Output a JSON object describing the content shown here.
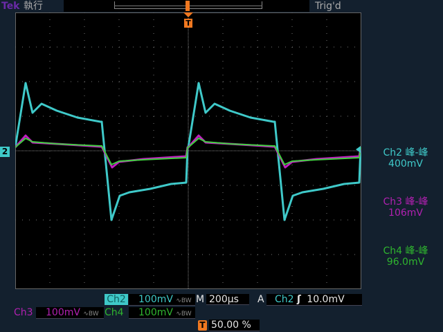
{
  "top": {
    "brand": "Tek",
    "run_state": "執行",
    "trigger_status": "Trig'd",
    "trigger_marker": "T"
  },
  "readouts": [
    {
      "label": "Ch2 峰-峰",
      "value": "400mV",
      "color": "#3fc9c9"
    },
    {
      "label": "Ch3 峰-峰",
      "value": "106mV",
      "color": "#b020b0"
    },
    {
      "label": "Ch4 峰-峰",
      "value": "96.0mV",
      "color": "#2fb52f"
    }
  ],
  "channel_marker": "2",
  "bottom": {
    "ch2": {
      "label": "Ch2",
      "scale": "100mV",
      "bw": "∿BW"
    },
    "ch3": {
      "label": "Ch3",
      "scale": "100mV",
      "bw": "∿BW"
    },
    "ch4": {
      "label": "Ch4",
      "scale": "100mV",
      "bw": "∿BW"
    },
    "timebase": {
      "label": "M",
      "value": "200µs"
    },
    "trigger": {
      "mode": "A",
      "source": "Ch2",
      "slope": "ʃ",
      "level": "10.0mV"
    },
    "position": {
      "badge": "T",
      "value": "50.00 %"
    }
  },
  "colors": {
    "ch2": "#3fc9c9",
    "ch3": "#c020c0",
    "ch4": "#40d040",
    "trigger": "#f07820"
  }
}
